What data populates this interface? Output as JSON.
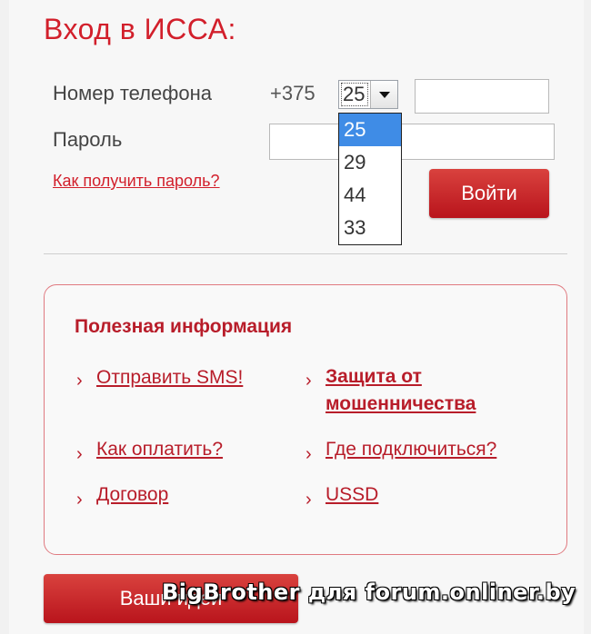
{
  "login": {
    "title": "Вход в ИССА:",
    "phone_label": "Номер телефона",
    "country_code": "+375",
    "operator_code_selected": "25",
    "operator_code_options": [
      "25",
      "29",
      "44",
      "33"
    ],
    "password_label": "Пароль",
    "forgot_link": "Как получить пароль?",
    "submit_label": "Войти"
  },
  "info": {
    "title": "Полезная информация",
    "links": [
      "Отправить SMS!",
      "Защита от мошенничества",
      "Как оплатить?",
      "Где подключиться?",
      "Договор",
      "USSD"
    ],
    "bold_link_lines": [
      "Защита от",
      "мошенничества"
    ]
  },
  "ideas_button": "Ваши идеи",
  "watermark": "BigBrother для forum.onliner.by",
  "colors": {
    "brand_red": "#d21f2b",
    "selected_option": "#3f8ce6"
  },
  "icons": {
    "dropdown": "triangle-down",
    "link_bullet": "chevron-right"
  }
}
